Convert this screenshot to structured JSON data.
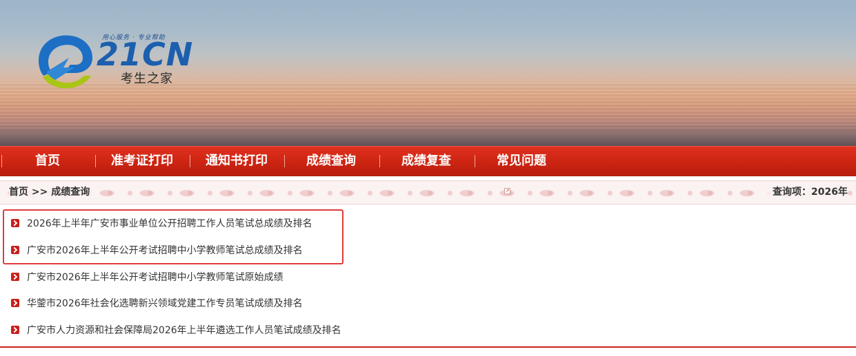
{
  "logo": {
    "slogan": "用心服务 · 专业帮助",
    "brand": "21CN",
    "subtitle": "考生之家"
  },
  "nav": {
    "items": [
      {
        "label": "首页"
      },
      {
        "label": "准考证打印"
      },
      {
        "label": "通知书打印"
      },
      {
        "label": "成绩查询"
      },
      {
        "label": "成绩复查"
      },
      {
        "label": "常见问题"
      }
    ]
  },
  "breadcrumb": {
    "home": "首页",
    "separator": ">>",
    "current": "成绩查询",
    "ext_icon": "↗"
  },
  "query": {
    "label": "查询项：2026年"
  },
  "results": [
    {
      "title": "2026年上半年广安市事业单位公开招聘工作人员笔试总成绩及排名",
      "highlighted": true
    },
    {
      "title": "广安市2026年上半年公开考试招聘中小学教师笔试总成绩及排名",
      "highlighted": true
    },
    {
      "title": "广安市2026年上半年公开考试招聘中小学教师笔试原始成绩",
      "highlighted": false
    },
    {
      "title": "华蓥市2026年社会化选聘新兴领域党建工作专员笔试成绩及排名",
      "highlighted": false
    },
    {
      "title": "广安市人力资源和社会保障局2026年上半年遴选工作人员笔试成绩及排名",
      "highlighted": false
    }
  ],
  "colors": {
    "nav_red": "#cc2412",
    "bullet_red": "#c8201b",
    "highlight_red": "#e03a3a",
    "brand_blue": "#1c5fae",
    "logo_green": "#a9c515"
  },
  "icons": {
    "bullet": "red-square-chevron-right-icon",
    "logo_mark": "blue-green-swirl-logo-icon",
    "external": "external-link-icon"
  }
}
